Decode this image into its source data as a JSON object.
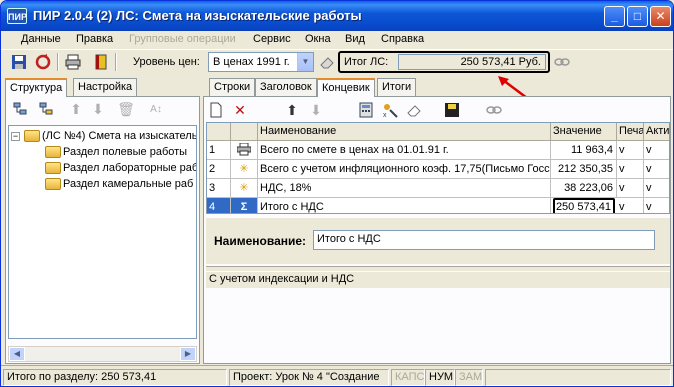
{
  "window": {
    "title": "ПИР 2.0.4  (2) ЛС: Смета на изыскательские работы",
    "app_icon_text": "ПИР",
    "minimize_label": "_",
    "maximize_label": "□",
    "close_label": "✕"
  },
  "menu": {
    "items": [
      "Данные",
      "Правка",
      "Групповые операции",
      "Сервис",
      "Окна",
      "Вид",
      "Справка"
    ]
  },
  "toolbar": {
    "price_level_label": "Уровень цен:",
    "price_level_value": "В ценах 1991 г.",
    "total_label": "Итог ЛС:",
    "total_value": "250 573,41 Руб."
  },
  "left": {
    "tabs": [
      "Структура",
      "Настройка"
    ],
    "active_tab": 0,
    "tree": {
      "root_label": "(ЛС №4) Смета на изыскатель",
      "children": [
        "Раздел полевые работы",
        "Раздел лабораторные раб",
        "Раздел камеральные раб"
      ]
    }
  },
  "right": {
    "tabs": [
      "Строки",
      "Заголовок",
      "Концевик",
      "Итоги"
    ],
    "active_tab": 2,
    "grid": {
      "columns": [
        "Наименование",
        "Значение",
        "Печа",
        "Акти"
      ],
      "rows": [
        {
          "num": "1",
          "icon": "printer-icon",
          "name": "Всего по смете в ценах на 01.01.91 г.",
          "value": "11 963,4",
          "print": "v",
          "active": "v"
        },
        {
          "num": "2",
          "icon": "asterisk-icon",
          "name": "Всего с учетом инфляционного коэф. 17,75(Письмо Госс",
          "value": "212 350,35",
          "print": "v",
          "active": "v"
        },
        {
          "num": "3",
          "icon": "asterisk-icon",
          "name": "НДС, 18%",
          "value": "38 223,06",
          "print": "v",
          "active": "v"
        },
        {
          "num": "4",
          "icon": "sigma-icon",
          "name": "Итого с НДС",
          "value": "250 573,41",
          "print": "v",
          "active": "v"
        }
      ]
    },
    "name_label": "Наименование:",
    "name_value": "Итого с НДС",
    "note": "С учетом индексации и НДС"
  },
  "status": {
    "section_total": "Итого по разделу: 250 573,41",
    "project": "Проект: Урок № 4 \"Создание",
    "caps": "КАПС",
    "num": "НУМ",
    "scroll": "ЗАМ"
  },
  "colors": {
    "titlebar": "#0a5fe6",
    "selection": "#316ac5",
    "annotation_arrow": "#e00000",
    "tab_accent": "#e68b2c"
  }
}
